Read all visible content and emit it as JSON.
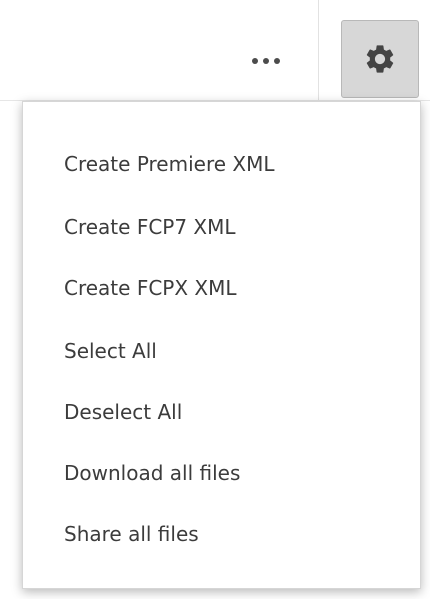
{
  "toolbar": {
    "more_icon": "ellipsis-icon",
    "settings_icon": "gear-icon"
  },
  "menu": {
    "items": [
      {
        "label": "Create Premiere XML"
      },
      {
        "label": "Create FCP7 XML"
      },
      {
        "label": "Create FCPX XML"
      },
      {
        "label": "Select All"
      },
      {
        "label": "Deselect All"
      },
      {
        "label": "Download all files"
      },
      {
        "label": "Share all files"
      }
    ]
  },
  "colors": {
    "text": "#3c3c3c",
    "icon": "#4c4c4c",
    "active_button_bg": "#d7d7d7"
  }
}
